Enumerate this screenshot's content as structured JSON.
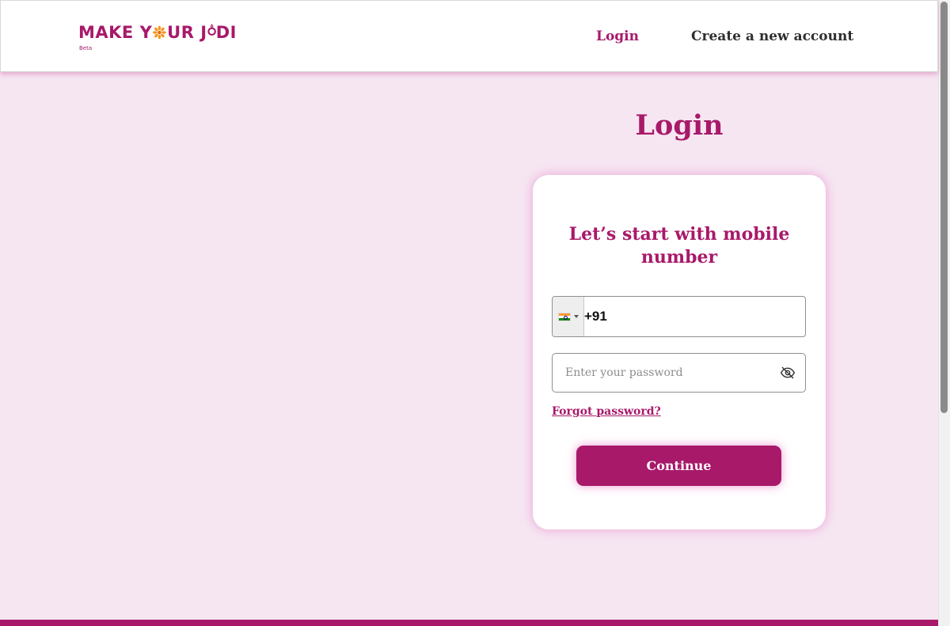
{
  "header": {
    "logo": {
      "text_before": "MAKE Y",
      "text_after": "UR J",
      "text_end": "DI",
      "beta_label": "Beta",
      "brand_color": "#a8196a",
      "accent_color": "#f7941d"
    },
    "nav": {
      "login_label": "Login",
      "create_account_label": "Create a new account"
    }
  },
  "main": {
    "page_title": "Login",
    "card": {
      "heading": "Let’s start with mobile number",
      "phone": {
        "country_flag": "india-flag-icon",
        "value": "+91"
      },
      "password": {
        "placeholder": "Enter your password",
        "visibility_icon": "eye-off-icon"
      },
      "forgot_password_label": "Forgot password?",
      "continue_label": "Continue"
    }
  },
  "colors": {
    "primary": "#a8196a",
    "background": "#f6e6f2"
  }
}
